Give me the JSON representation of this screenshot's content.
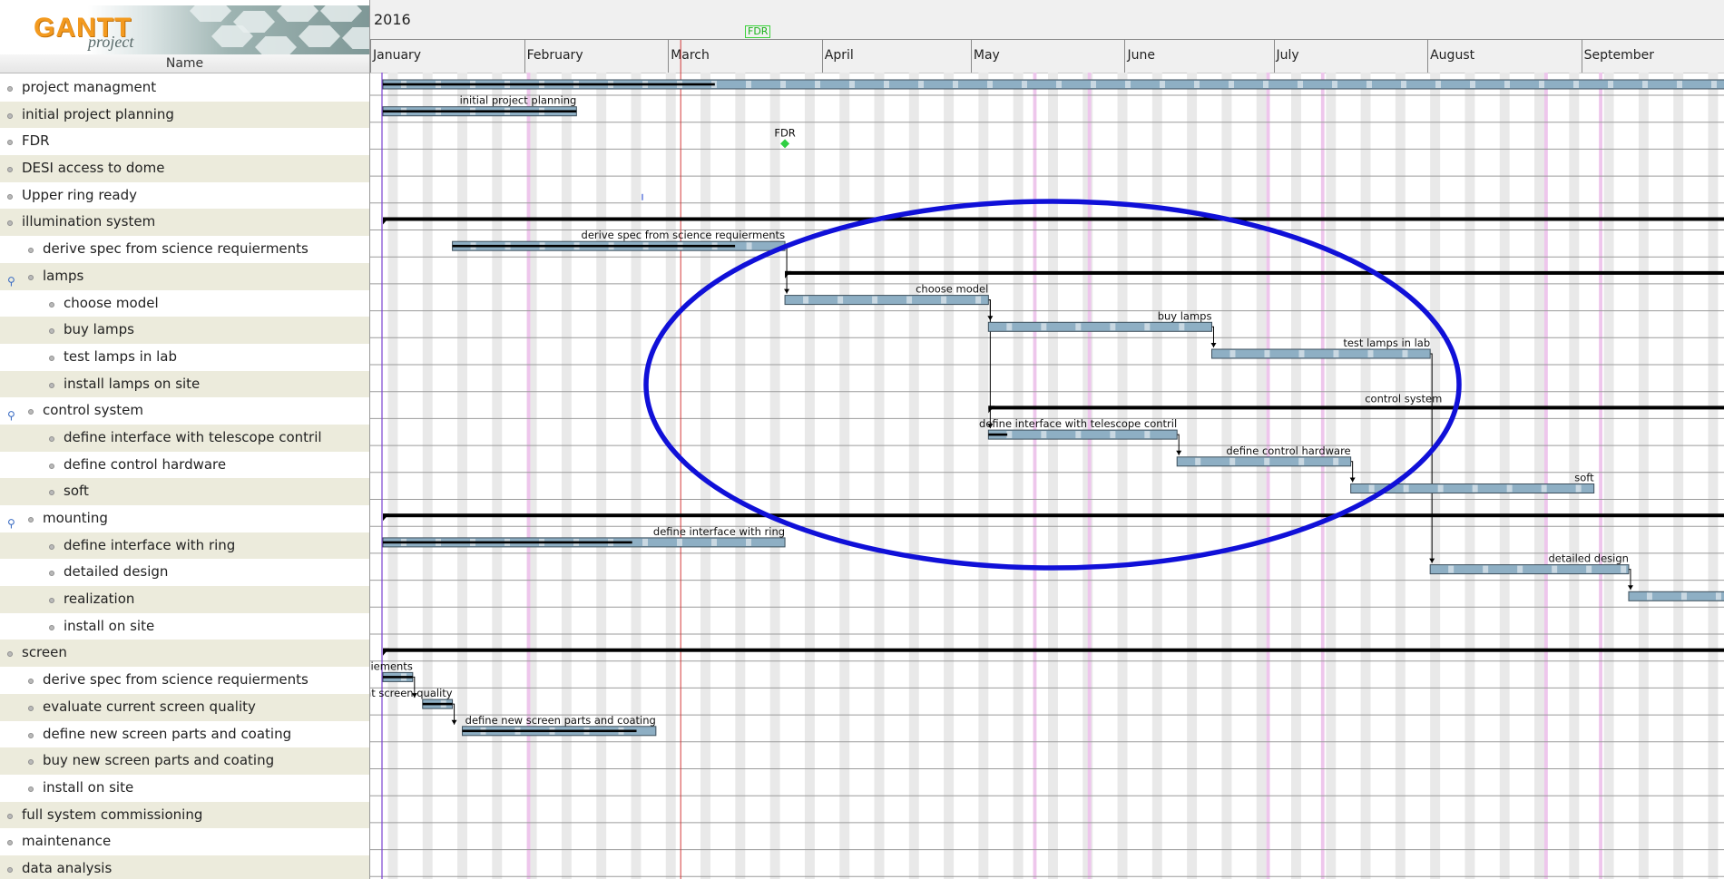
{
  "app": {
    "logo_word": "GANTT",
    "logo_sub": "project"
  },
  "tree": {
    "name_header": "Name",
    "tasks": [
      {
        "label": "project managment",
        "level": 0,
        "expander": false
      },
      {
        "label": "initial project planning",
        "level": 0,
        "expander": false
      },
      {
        "label": "FDR",
        "level": 0,
        "expander": false
      },
      {
        "label": "DESI access to dome",
        "level": 0,
        "expander": false
      },
      {
        "label": "Upper ring ready",
        "level": 0,
        "expander": false
      },
      {
        "label": "illumination system",
        "level": 0,
        "expander": false
      },
      {
        "label": "derive spec from science requierments",
        "level": 1,
        "expander": false
      },
      {
        "label": "lamps",
        "level": 1,
        "expander": true
      },
      {
        "label": "choose model",
        "level": 2,
        "expander": false
      },
      {
        "label": "buy lamps",
        "level": 2,
        "expander": false
      },
      {
        "label": "test lamps in lab",
        "level": 2,
        "expander": false
      },
      {
        "label": "install lamps on site",
        "level": 2,
        "expander": false
      },
      {
        "label": "control system",
        "level": 1,
        "expander": true
      },
      {
        "label": "define interface with telescope contril",
        "level": 2,
        "expander": false
      },
      {
        "label": "define control hardware",
        "level": 2,
        "expander": false
      },
      {
        "label": "soft",
        "level": 2,
        "expander": false
      },
      {
        "label": "mounting",
        "level": 1,
        "expander": true
      },
      {
        "label": "define interface with ring",
        "level": 2,
        "expander": false
      },
      {
        "label": "detailed design",
        "level": 2,
        "expander": false
      },
      {
        "label": "realization",
        "level": 2,
        "expander": false
      },
      {
        "label": "install on site",
        "level": 2,
        "expander": false
      },
      {
        "label": "screen",
        "level": 0,
        "expander": false
      },
      {
        "label": "derive spec from science requierments",
        "level": 1,
        "expander": false
      },
      {
        "label": "evaluate current screen quality",
        "level": 1,
        "expander": false
      },
      {
        "label": "define new screen parts and coating",
        "level": 1,
        "expander": false
      },
      {
        "label": "buy new screen parts and coating",
        "level": 1,
        "expander": false
      },
      {
        "label": "install on site",
        "level": 1,
        "expander": false
      },
      {
        "label": "full system commissioning",
        "level": 0,
        "expander": false
      },
      {
        "label": "maintenance",
        "level": 0,
        "expander": false
      },
      {
        "label": "data analysis",
        "level": 0,
        "expander": false
      }
    ]
  },
  "timeline": {
    "year": "2016",
    "start": "2016-01-01",
    "months": [
      "January",
      "February",
      "March",
      "April",
      "May",
      "June",
      "July",
      "August",
      "September"
    ],
    "today": "2016-03-01",
    "milestone_header_label": "FDR"
  },
  "colors": {
    "bar_fill": "#8eafc4",
    "bar_stripe": "#c9d8e2",
    "bar_border": "#3d4f5c",
    "summary": "#000000",
    "milestone": "#2fcf43",
    "today_line": "#d23a3a",
    "holiday": "#eec6ec",
    "weekend": "#e9e9e9",
    "annotation_ellipse": "#1010d8"
  },
  "bars": [
    {
      "row": 0,
      "start": "2016-01-01",
      "end": "2016-10-31",
      "progress": 0.22,
      "label": ""
    },
    {
      "row": 1,
      "start": "2016-01-01",
      "end": "2016-02-09",
      "progress": 1.0,
      "label": "initial project planning"
    },
    {
      "row": 6,
      "start": "2016-01-15",
      "end": "2016-03-22",
      "progress": 0.85,
      "label": "derive spec from science requierments"
    },
    {
      "row": 8,
      "start": "2016-03-22",
      "end": "2016-05-02",
      "progress": 0,
      "label": "choose model"
    },
    {
      "row": 9,
      "start": "2016-05-02",
      "end": "2016-06-16",
      "progress": 0,
      "label": "buy lamps"
    },
    {
      "row": 10,
      "start": "2016-06-16",
      "end": "2016-07-30",
      "progress": 0,
      "label": "test lamps in lab"
    },
    {
      "row": 13,
      "start": "2016-05-02",
      "end": "2016-06-09",
      "progress": 0.1,
      "label": "define interface with telescope contril"
    },
    {
      "row": 14,
      "start": "2016-06-09",
      "end": "2016-07-14",
      "progress": 0,
      "label": "define control hardware"
    },
    {
      "row": 15,
      "start": "2016-07-14",
      "end": "2016-09-01",
      "progress": 0,
      "label": "soft"
    },
    {
      "row": 17,
      "start": "2016-01-01",
      "end": "2016-03-22",
      "progress": 0.62,
      "label": "define interface with ring"
    },
    {
      "row": 18,
      "start": "2016-07-30",
      "end": "2016-09-08",
      "progress": 0,
      "label": "detailed design"
    },
    {
      "row": 19,
      "start": "2016-09-08",
      "end": "2016-10-31",
      "progress": 0,
      "label": "realization"
    },
    {
      "row": 22,
      "start": "2016-01-01",
      "end": "2016-01-07",
      "progress": 1.0,
      "label": "iements"
    },
    {
      "row": 23,
      "start": "2016-01-09",
      "end": "2016-01-15",
      "progress": 1.0,
      "label": "nt screen quality"
    },
    {
      "row": 24,
      "start": "2016-01-17",
      "end": "2016-02-25",
      "progress": 0.9,
      "label": "define new screen parts and coating"
    }
  ],
  "summaries": [
    {
      "row": 5,
      "start": "2016-01-01",
      "end": "2016-10-31"
    },
    {
      "row": 7,
      "start": "2016-03-22",
      "end": "2016-10-31"
    },
    {
      "row": 12,
      "start": "2016-05-02",
      "end": "2016-10-31",
      "label": "control system"
    },
    {
      "row": 16,
      "start": "2016-01-01",
      "end": "2016-10-31"
    },
    {
      "row": 21,
      "start": "2016-01-01",
      "end": "2016-10-31"
    }
  ],
  "milestones": [
    {
      "row": 2,
      "date": "2016-03-22",
      "label": "FDR"
    }
  ],
  "dependencies": [
    {
      "from": 6,
      "to": 8
    },
    {
      "from": 8,
      "to": 9
    },
    {
      "from": 9,
      "to": 10
    },
    {
      "from": 8,
      "to": 13
    },
    {
      "from": 13,
      "to": 14
    },
    {
      "from": 14,
      "to": 15
    },
    {
      "from": 10,
      "to": 18
    },
    {
      "from": 18,
      "to": 19
    },
    {
      "from": 22,
      "to": 23
    },
    {
      "from": 23,
      "to": 24
    }
  ]
}
